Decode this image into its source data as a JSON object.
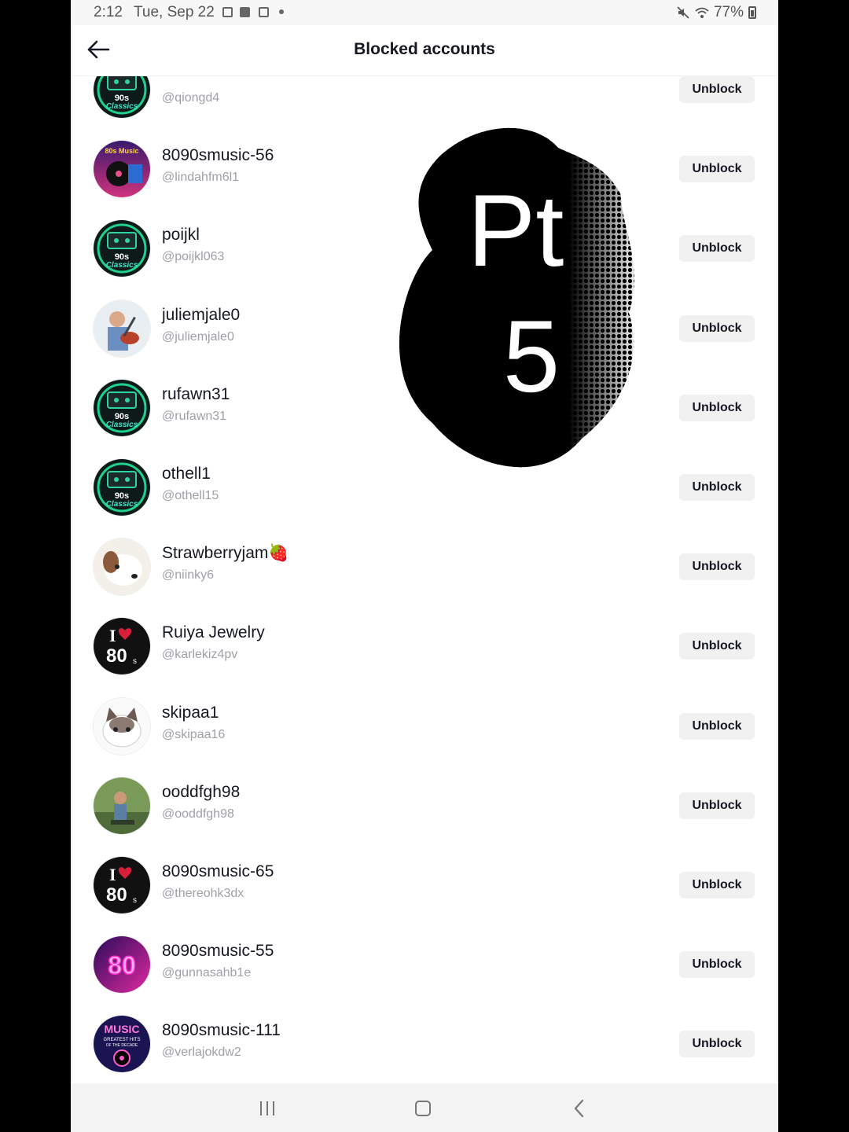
{
  "status_bar": {
    "time": "2:12",
    "date": "Tue, Sep 22",
    "battery": "77%"
  },
  "header": {
    "title": "Blocked accounts",
    "back_icon": "arrow-left-icon"
  },
  "overlay": {
    "line1": "Pt",
    "line2": "5"
  },
  "accounts": [
    {
      "name": "",
      "handle": "@qiongd4",
      "avatar": "90s-classics",
      "button": "Unblock"
    },
    {
      "name": "8090smusic-56",
      "handle": "@lindahfm6l1",
      "avatar": "80s-music",
      "button": "Unblock"
    },
    {
      "name": "poijkl",
      "handle": "@poijkl063",
      "avatar": "90s-classics",
      "button": "Unblock"
    },
    {
      "name": "juliemjale0",
      "handle": "@juliemjale0",
      "avatar": "guitar-photo",
      "button": "Unblock"
    },
    {
      "name": "rufawn31",
      "handle": "@rufawn31",
      "avatar": "90s-classics",
      "button": "Unblock"
    },
    {
      "name": "othell1",
      "handle": "@othell15",
      "avatar": "90s-classics",
      "button": "Unblock"
    },
    {
      "name": "Strawberryjam🍓",
      "handle": "@niinky6",
      "avatar": "dog-photo",
      "button": "Unblock"
    },
    {
      "name": "Ruiya Jewelry",
      "handle": "@karlekiz4pv",
      "avatar": "i-love-80s",
      "button": "Unblock"
    },
    {
      "name": "skipaa1",
      "handle": "@skipaa16",
      "avatar": "cat-cartoon",
      "button": "Unblock"
    },
    {
      "name": "ooddfgh98",
      "handle": "@ooddfgh98",
      "avatar": "person-photo",
      "button": "Unblock"
    },
    {
      "name": "8090smusic-65",
      "handle": "@thereohk3dx",
      "avatar": "i-love-80s",
      "button": "Unblock"
    },
    {
      "name": "8090smusic-55",
      "handle": "@gunnasahb1e",
      "avatar": "neon-80",
      "button": "Unblock"
    },
    {
      "name": "8090smusic-111",
      "handle": "@verlajokdw2",
      "avatar": "music-hits",
      "button": "Unblock"
    }
  ],
  "avatar_labels": {
    "nineties": "90s",
    "classics": "Classics",
    "eighties_music": "80s Music",
    "i_letter": "I",
    "eighty": "80",
    "s_suffix": "s",
    "music": "MUSIC",
    "greatest_hits": "GREATEST HITS",
    "of_the_decade": "OF THE DECADE"
  },
  "colors": {
    "background": "#ffffff",
    "text_primary": "#161823",
    "text_secondary": "#a0a0a8",
    "button_bg": "#f1f1f2",
    "side_bars": "#000000"
  }
}
